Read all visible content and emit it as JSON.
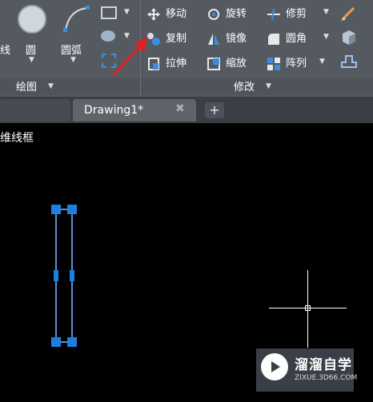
{
  "ribbon": {
    "left_items": {
      "line_label_fragment": "线",
      "circle_label": "圆",
      "arc_label": "圆弧"
    },
    "draw_panel_title": "绘图",
    "modify_panel_title": "修改",
    "modify_tools": [
      {
        "label": "移动",
        "icon": "move-icon"
      },
      {
        "label": "旋转",
        "icon": "rotate-icon"
      },
      {
        "label": "修剪",
        "icon": "trim-icon"
      },
      {
        "label": "复制",
        "icon": "copy-icon"
      },
      {
        "label": "镜像",
        "icon": "mirror-icon"
      },
      {
        "label": "圆角",
        "icon": "fillet-icon"
      },
      {
        "label": "拉伸",
        "icon": "stretch-icon"
      },
      {
        "label": "缩放",
        "icon": "scale-icon"
      },
      {
        "label": "阵列",
        "icon": "array-icon"
      }
    ]
  },
  "tabs": {
    "active": "Drawing1*"
  },
  "canvas": {
    "viewport_label": "维线框"
  },
  "watermark": {
    "brand": "溜溜自学",
    "url": "ZIXUE.3D66.COM"
  },
  "colors": {
    "ribbon_bg": "#555a61",
    "canvas_bg": "#000000",
    "grip": "#1f7fe0",
    "arrow": "#e02020"
  }
}
